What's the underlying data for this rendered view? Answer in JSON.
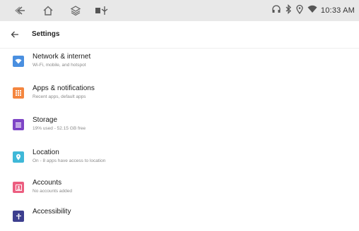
{
  "status_bar": {
    "time": "10:33 AM",
    "left_icons": [
      "back-nav-icon",
      "home-icon",
      "layers-icon",
      "notification-icons"
    ],
    "right_icons": [
      "headset-icon",
      "bluetooth-icon",
      "location-icon",
      "wifi-icon"
    ]
  },
  "app_bar": {
    "title": "Settings"
  },
  "settings": {
    "items": [
      {
        "title": "Network & internet",
        "subtitle": "Wi-Fi, mobile, and hotspot",
        "icon": "wifi-icon",
        "color": "#4a8fe0"
      },
      {
        "title": "Apps & notifications",
        "subtitle": "Recent apps, default apps",
        "icon": "apps-grid-icon",
        "color": "#f4863f"
      },
      {
        "title": "Storage",
        "subtitle": "19% used - 52.15 GB free",
        "icon": "storage-icon",
        "color": "#7e45c6"
      },
      {
        "title": "Location",
        "subtitle": "On - 8 apps have access to location",
        "icon": "location-pin-icon",
        "color": "#3fb8d8"
      },
      {
        "title": "Accounts",
        "subtitle": "No accounts added",
        "icon": "account-box-icon",
        "color": "#ec5e80"
      },
      {
        "title": "Accessibility",
        "subtitle": "",
        "icon": "accessibility-icon",
        "color": "#3d3f8f"
      }
    ]
  }
}
